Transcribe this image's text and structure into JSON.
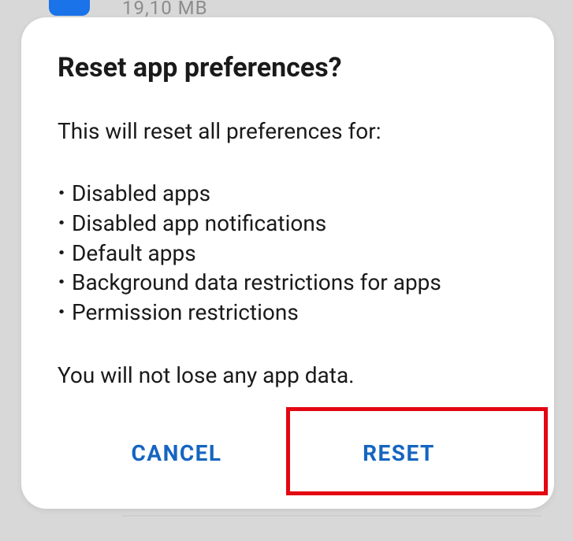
{
  "background": {
    "app_size": "19,10 MB"
  },
  "dialog": {
    "title": "Reset app preferences?",
    "intro": "This will reset all preferences for:",
    "items": [
      "Disabled apps",
      "Disabled app notifications",
      "Default apps",
      "Background data restrictions for apps",
      "Permission restrictions"
    ],
    "footer_text": "You will not lose any app data.",
    "cancel_label": "CANCEL",
    "reset_label": "RESET"
  }
}
